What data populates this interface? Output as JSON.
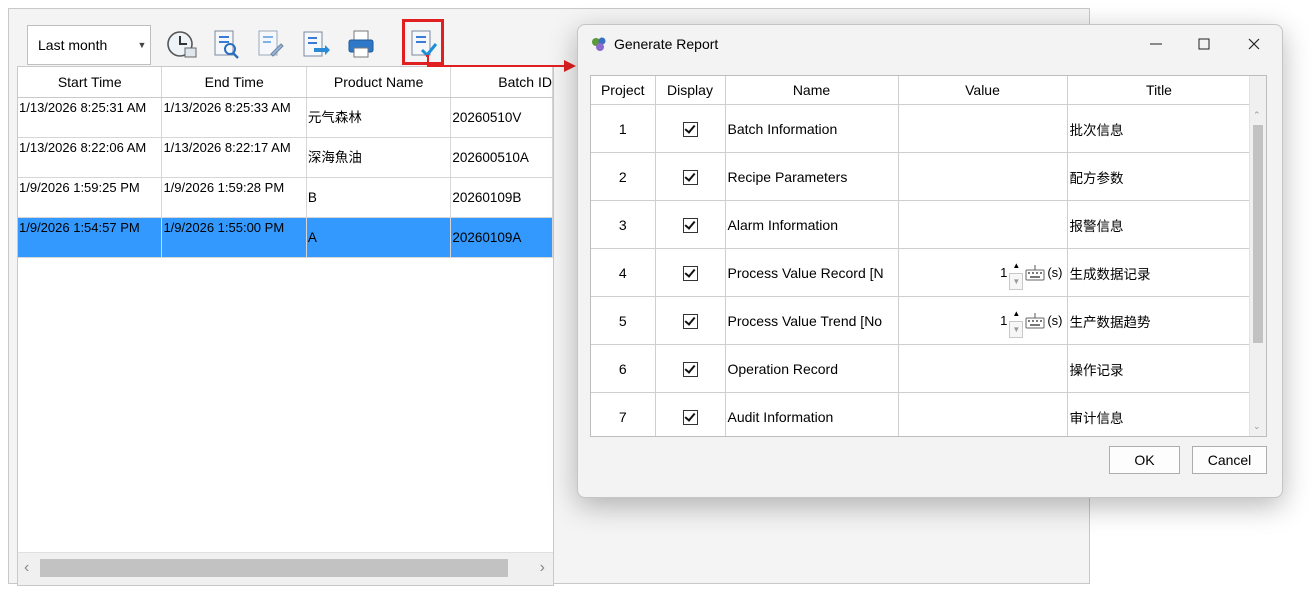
{
  "toolbar": {
    "range_value": "Last month",
    "buttons": [
      "clock-icon",
      "search-report-icon",
      "edit-report-icon",
      "export-icon",
      "print-icon",
      "generate-report-icon"
    ]
  },
  "grid": {
    "columns": [
      "Start Time",
      "End Time",
      "Product Name",
      "Batch ID"
    ],
    "rows": [
      {
        "start": "1/13/2026 8:25:31 AM",
        "end": "1/13/2026 8:25:33 AM",
        "product": "元气森林",
        "batch": "20260510V"
      },
      {
        "start": "1/13/2026 8:22:06 AM",
        "end": "1/13/2026 8:22:17 AM",
        "product": "深海魚油",
        "batch": "202600510A"
      },
      {
        "start": "1/9/2026 1:59:25 PM",
        "end": "1/9/2026 1:59:28 PM",
        "product": "B",
        "batch": "20260109B"
      },
      {
        "start": "1/9/2026 1:54:57 PM",
        "end": "1/9/2026 1:55:00 PM",
        "product": "A",
        "batch": "20260109A",
        "selected": true
      }
    ]
  },
  "dialog": {
    "title": "Generate Report",
    "columns": [
      "Project",
      "Display",
      "Name",
      "Value",
      "Title"
    ],
    "rows": [
      {
        "project": "1",
        "display": true,
        "name": "Batch Information",
        "value": "",
        "title": "批次信息"
      },
      {
        "project": "2",
        "display": true,
        "name": "Recipe Parameters",
        "value": "",
        "title": "配方参数"
      },
      {
        "project": "3",
        "display": true,
        "name": "Alarm Information",
        "value": "",
        "title": "报警信息"
      },
      {
        "project": "4",
        "display": true,
        "name": "Process Value Record [N",
        "value": "1",
        "unit": "(s)",
        "title": "生成数据记录"
      },
      {
        "project": "5",
        "display": true,
        "name": "Process Value Trend [No",
        "value": "1",
        "unit": "(s)",
        "title": "生产数据趋势"
      },
      {
        "project": "6",
        "display": true,
        "name": "Operation Record",
        "value": "",
        "title": "操作记录"
      },
      {
        "project": "7",
        "display": true,
        "name": "Audit Information",
        "value": "",
        "title": "审计信息"
      }
    ],
    "ok_label": "OK",
    "cancel_label": "Cancel"
  },
  "colors": {
    "selection": "#3399ff",
    "highlight": "#e02020"
  }
}
